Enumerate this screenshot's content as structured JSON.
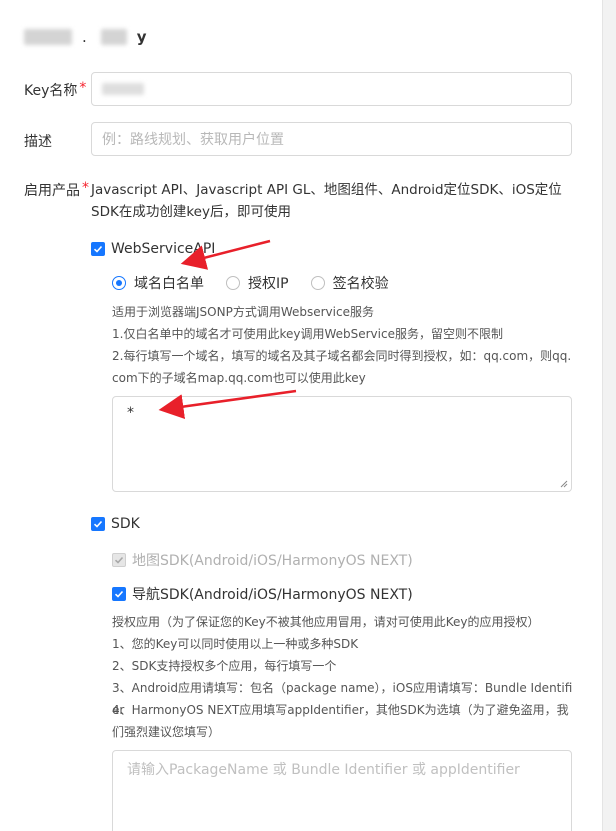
{
  "header": {
    "title_suffix": "y",
    "title_dot": "."
  },
  "form": {
    "key_name": {
      "label": "Key名称",
      "required_mark": "*",
      "value": ""
    },
    "description": {
      "label": "描述",
      "placeholder": "例：路线规划、获取用户位置"
    },
    "products": {
      "label": "启用产品",
      "required_mark": "*",
      "intro": "Javascript API、Javascript API GL、地图组件、Android定位SDK、iOS定位SDK在成功创建key后，即可使用"
    },
    "webservice": {
      "label": "WebServiceAPI",
      "checked": true,
      "radios": [
        {
          "label": "域名白名单",
          "selected": true
        },
        {
          "label": "授权IP",
          "selected": false
        },
        {
          "label": "签名校验",
          "selected": false
        }
      ],
      "hints": [
        "适用于浏览器端JSONP方式调用Webservice服务",
        "1.仅白名单中的域名才可使用此key调用WebService服务，留空则不限制",
        "2.每行填写一个域名，填写的域名及其子域名都会同时得到授权，如：qq.com，则qq.com下的子域名map.qq.com也可以使用此key"
      ],
      "whitelist_value": "*"
    },
    "sdk": {
      "label": "SDK",
      "checked": true,
      "map_sdk": {
        "label": "地图SDK(Android/iOS/HarmonyOS NEXT)",
        "checked": true,
        "disabled": true
      },
      "nav_sdk": {
        "label": "导航SDK(Android/iOS/HarmonyOS NEXT)",
        "checked": true
      },
      "hints": [
        "授权应用（为了保证您的Key不被其他应用冒用，请对可使用此Key的应用授权）",
        "1、您的Key可以同时使用以上一种或多种SDK",
        "2、SDK支持授权多个应用，每行填写一个",
        "3、Android应用请填写：包名（package name），iOS应用请填写：Bundle Identifier",
        "4、HarmonyOS NEXT应用填写appIdentifier，其他SDK为选填（为了避免盗用，我们强烈建议您填写）"
      ],
      "apps_placeholder": "请输入PackageName 或 Bundle Identifier 或 appIdentifier"
    }
  },
  "colors": {
    "accent": "#1677ff",
    "required": "#f5222d",
    "annotation_arrow": "#e8202a"
  },
  "icons": {
    "checkbox": "check-icon",
    "arrow": "annotation-arrow-icon"
  }
}
